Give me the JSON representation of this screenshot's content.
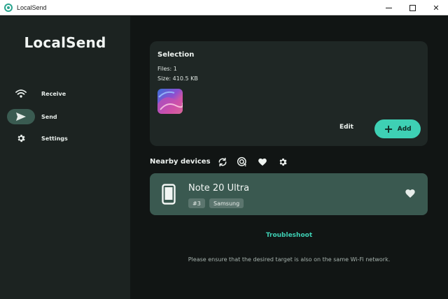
{
  "window": {
    "title": "LocalSend",
    "controls": {
      "minimize": "minimize",
      "maximize": "maximize",
      "close": "✕"
    }
  },
  "sidebar": {
    "brand": "LocalSend",
    "items": [
      {
        "label": "Receive",
        "icon": "wifi-icon",
        "active": false
      },
      {
        "label": "Send",
        "icon": "send-icon",
        "active": true
      },
      {
        "label": "Settings",
        "icon": "gear-icon",
        "active": false
      }
    ]
  },
  "selection": {
    "title": "Selection",
    "files": "Files: 1",
    "size": "Size: 410.5 KB",
    "edit_label": "Edit",
    "add_label": "Add"
  },
  "nearby": {
    "title": "Nearby devices",
    "icons": [
      "refresh-icon",
      "scan-target-icon",
      "heart-icon",
      "gear-icon"
    ]
  },
  "devices": [
    {
      "name": "Note 20 Ultra",
      "tags": [
        "#3",
        "Samsung"
      ],
      "icon": "smartphone-icon",
      "favorite_icon": "heart-icon"
    }
  ],
  "troubleshoot_label": "Troubleshoot",
  "hint": "Please ensure that the desired target is also on the same Wi-Fi network.",
  "colors": {
    "accent": "#3ed0b4",
    "sidebar_bg": "#1c2321",
    "main_bg": "#111514",
    "card_bg": "#1f2725",
    "device_bg": "#3a5950",
    "active_pill": "#3a5b51"
  }
}
